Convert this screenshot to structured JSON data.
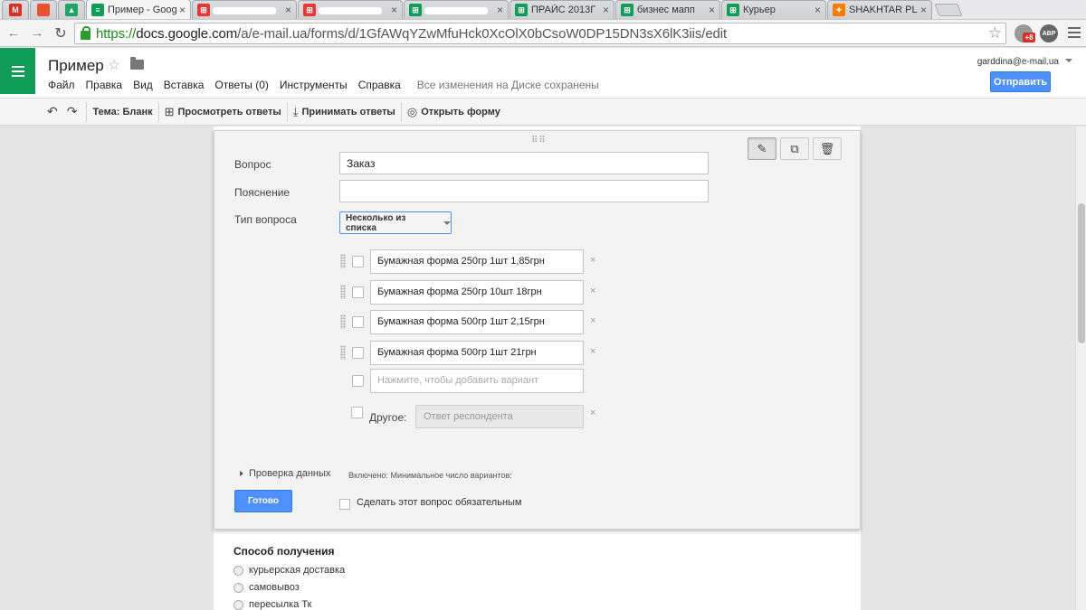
{
  "browser": {
    "tabs": [
      {
        "label": "",
        "favicon": "gmail-icon",
        "narrow": true,
        "color": "#d93025",
        "glyph": "M"
      },
      {
        "label": "",
        "favicon": "bookmark-icon",
        "narrow": true,
        "color": "#e8542f",
        "glyph": ""
      },
      {
        "label": "",
        "favicon": "drive-icon",
        "narrow": true,
        "color": "#1fa463",
        "glyph": "▲"
      },
      {
        "label": "Пример - Goog",
        "favicon": "forms-icon",
        "active": true,
        "color": "#0f9d58",
        "glyph": "≡"
      },
      {
        "label": "",
        "favicon": "shop-icon",
        "color": "#e53935",
        "glyph": "⊞",
        "redacted": true
      },
      {
        "label": "",
        "favicon": "shop-icon",
        "color": "#e53935",
        "glyph": "⊞",
        "redacted": true
      },
      {
        "label": "",
        "favicon": "sheets-icon",
        "color": "#0f9d58",
        "glyph": "⊞",
        "redacted": true
      },
      {
        "label": "ПРАЙС 2013Г",
        "favicon": "sheets-icon",
        "color": "#0f9d58",
        "glyph": "⊞"
      },
      {
        "label": "бизнес мапп",
        "favicon": "sheets-icon",
        "color": "#0f9d58",
        "glyph": "⊞"
      },
      {
        "label": "Курьер",
        "favicon": "sheets-icon",
        "color": "#0f9d58",
        "glyph": "⊞"
      },
      {
        "label": "SHAKHTAR PL",
        "favicon": "shakhtar-icon",
        "color": "#f57c00",
        "glyph": "✦"
      }
    ],
    "url": {
      "scheme": "https://",
      "domain": "docs.google.com",
      "path": "/a/e-mail.ua/forms/d/1GfAWqYZwMfuHck0XcOlX0bCsoW0DP15DN3sX6lK3iis/edit"
    },
    "extensions": [
      {
        "name": "notifications-icon",
        "color": "#999",
        "badge": "+8"
      },
      {
        "name": "adblock-icon",
        "color": "#666",
        "badge": "ABP"
      }
    ],
    "close_glyph": "×"
  },
  "docs": {
    "title": "Пример",
    "menu": [
      "Файл",
      "Правка",
      "Вид",
      "Вставка",
      "Ответы (0)",
      "Инструменты",
      "Справка"
    ],
    "save_status": "Все изменения на Диске сохранены",
    "account": "garddina@e-mail.ua",
    "send_label": "Отправить"
  },
  "action_bar": {
    "theme_label": "Тема: Бланк",
    "view_responses": "Просмотреть ответы",
    "accept_responses": "Принимать ответы",
    "open_form": "Открыть форму"
  },
  "question_editor": {
    "question_label": "Вопрос",
    "question_value": "Заказ",
    "help_label": "Пояснение",
    "help_value": "",
    "type_label": "Тип вопроса",
    "type_value": "Несколько из списка",
    "options": [
      "Бумажная форма 250гр 1шт 1,85грн",
      "Бумажная форма 250гр 10шт 18грн",
      "Бумажная форма 500гр 1шт 2,15грн",
      "Бумажная форма 500гр 1шт 21грн"
    ],
    "add_option_placeholder": "Нажмите, чтобы добавить вариант",
    "other_label": "Другое:",
    "other_placeholder": "Ответ респондента",
    "remove_glyph": "×",
    "validation_label": "Проверка данных",
    "validation_info": "Включено: Минимальное число вариантов:",
    "done_label": "Готово",
    "required_label": "Сделать этот вопрос обязательным"
  },
  "next_question": {
    "title": "Способ получения",
    "options": [
      "курьерская доставка",
      "самовывоз",
      "пересылка Тк"
    ]
  }
}
